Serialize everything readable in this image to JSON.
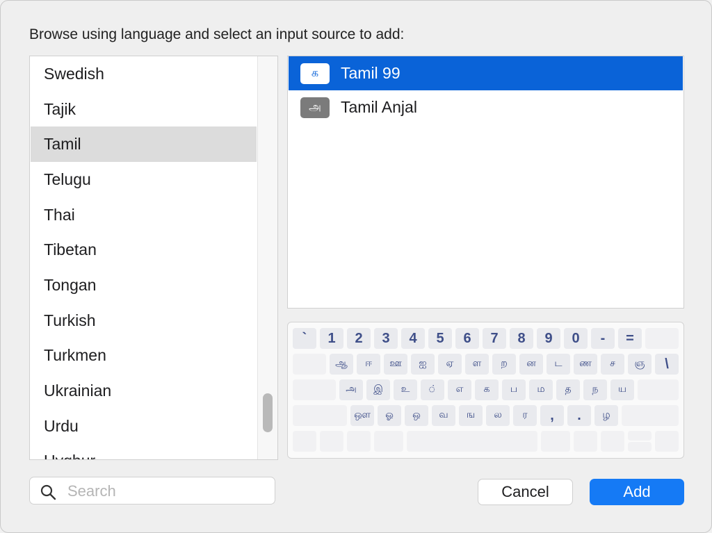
{
  "dialog": {
    "prompt": "Browse using language and select an input source to add:"
  },
  "languages": {
    "items": [
      "Swedish",
      "Tajik",
      "Tamil",
      "Telugu",
      "Thai",
      "Tibetan",
      "Tongan",
      "Turkish",
      "Turkmen",
      "Ukrainian",
      "Urdu",
      "Uyghur"
    ],
    "selected": "Tamil"
  },
  "input_sources": {
    "items": [
      {
        "label": "Tamil 99",
        "icon": "க",
        "selected": true
      },
      {
        "label": "Tamil Anjal",
        "icon": "அ",
        "selected": false
      }
    ]
  },
  "keyboard": {
    "rows": [
      [
        "`",
        "1",
        "2",
        "3",
        "4",
        "5",
        "6",
        "7",
        "8",
        "9",
        "0",
        "-",
        "="
      ],
      [
        "ஆ",
        "ஈ",
        "ஊ",
        "ஐ",
        "ஏ",
        "ள",
        "ற",
        "ன",
        "ட",
        "ண",
        "ச",
        "ஞ",
        "\\"
      ],
      [
        "அ",
        "இ",
        "உ",
        "்",
        "எ",
        "க",
        "ப",
        "ம",
        "த",
        "ந",
        "ய"
      ],
      [
        "ஔ",
        "ஓ",
        "ஒ",
        "வ",
        "ங",
        "ல",
        "ர",
        ",",
        ".",
        "ழ"
      ]
    ]
  },
  "search": {
    "placeholder": "Search",
    "value": ""
  },
  "buttons": {
    "cancel": "Cancel",
    "add": "Add"
  },
  "colors": {
    "accent": "#157af5",
    "selection": "#0a63d8"
  }
}
